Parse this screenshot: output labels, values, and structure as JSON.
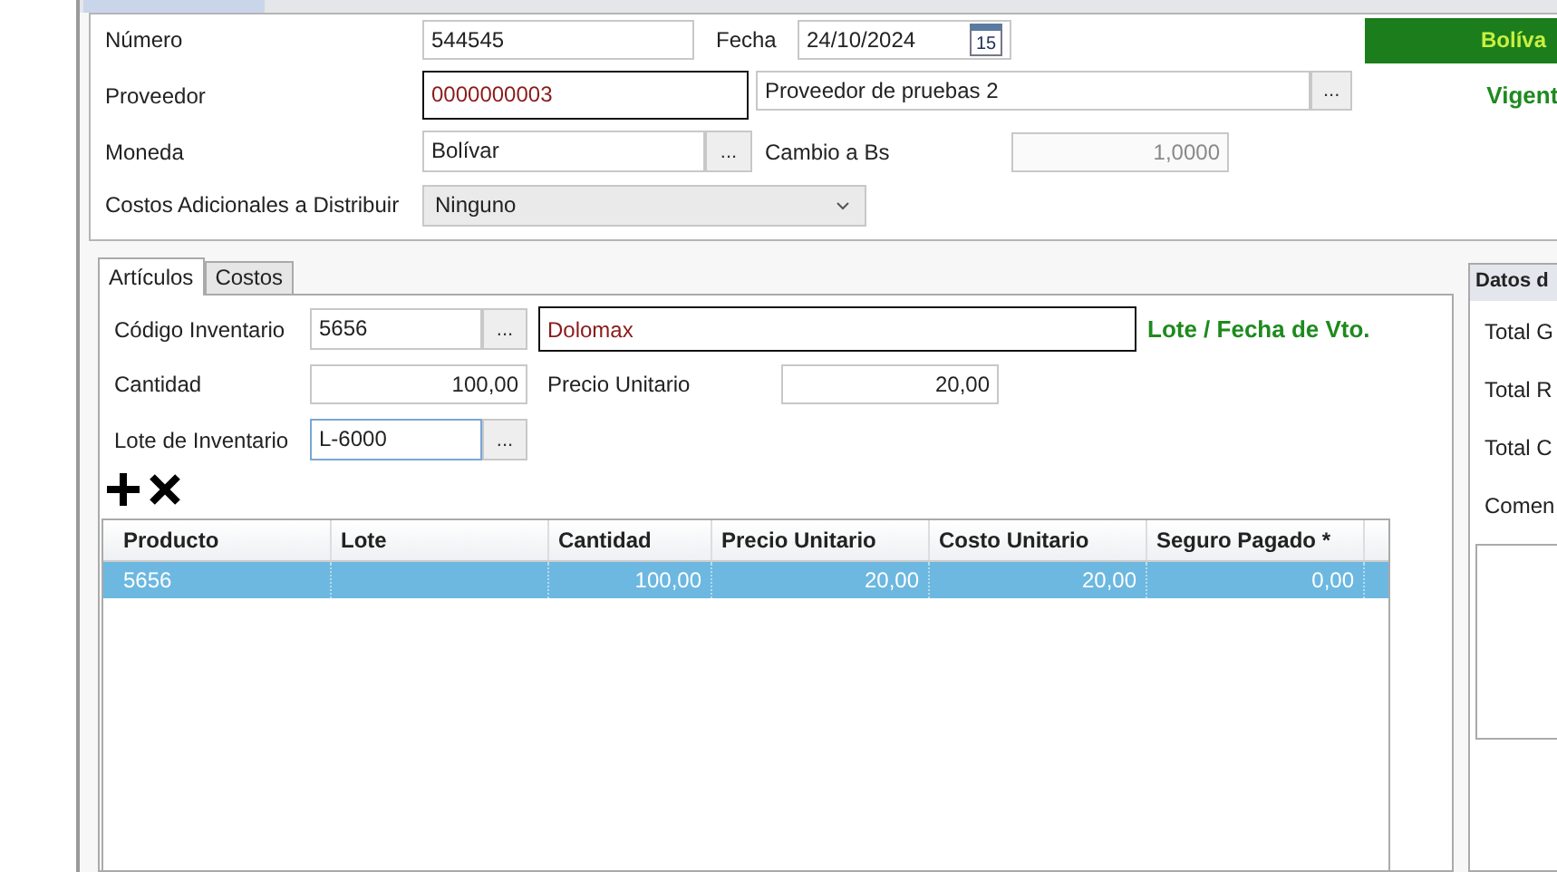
{
  "header": {
    "numero_label": "Número",
    "numero": "544545",
    "fecha_label": "Fecha",
    "fecha": "24/10/2024",
    "calendar_day": "15",
    "status_banner": "Bolíva",
    "proveedor_label": "Proveedor",
    "proveedor_code": "0000000003",
    "proveedor_name": "Proveedor de pruebas 2",
    "lookup": "...",
    "status_text": "Vigent",
    "moneda_label": "Moneda",
    "moneda": "Bolívar",
    "cambio_label": "Cambio a Bs",
    "cambio": "1,0000",
    "costos_label": "Costos Adicionales a Distribuir",
    "costos": "Ninguno"
  },
  "tabs": [
    {
      "label": "Artículos",
      "selected": true
    },
    {
      "label": "Costos",
      "selected": false
    }
  ],
  "articulo": {
    "codigo_label": "Código Inventario",
    "codigo": "5656",
    "lookup": "...",
    "descripcion": "Dolomax",
    "lote_fecha_link": "Lote / Fecha de Vto.",
    "cantidad_label": "Cantidad",
    "cantidad": "100,00",
    "precio_label": "Precio Unitario",
    "precio": "20,00",
    "lote_label": "Lote de Inventario",
    "lote": "L-6000"
  },
  "table": {
    "columns": [
      "Producto",
      "Lote",
      "Cantidad",
      "Precio Unitario",
      "Costo Unitario",
      "Seguro Pagado *"
    ],
    "rows": [
      {
        "selected": true,
        "cells": [
          "5656",
          "",
          "100,00",
          "20,00",
          "20,00",
          "0,00"
        ]
      }
    ]
  },
  "side_panel": {
    "title": "Datos d",
    "labels": [
      "Total G",
      "Total R",
      "Total C",
      "Comen"
    ]
  }
}
